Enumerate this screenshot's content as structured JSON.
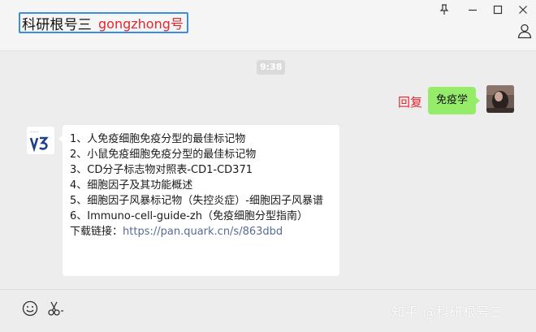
{
  "header": {
    "title": "科研根号三",
    "title_suffix": "gongzhong号"
  },
  "window_controls": {
    "pin": "pin-icon",
    "minimize": "minimize-icon",
    "maximize": "maximize-icon",
    "close": "close-icon"
  },
  "chat": {
    "timestamp": "9:38",
    "reply_label": "回复",
    "outgoing_message": "免疫学",
    "incoming_lines": [
      "1、人免疫细胞免疫分型的最佳标记物",
      "2、小鼠免疫细胞免疫分型的最佳标记物",
      "3、CD分子标志物对照表-CD1-CD371",
      "4、细胞因子及其功能概述",
      "5、细胞因子风暴标记物（失控炎症）-细胞因子风暴谱",
      "6、Immuno-cell-guide-zh（免疫细胞分型指南）"
    ],
    "download_label": "下载链接：",
    "download_link": "https://pan.quark.cn/s/863dbd"
  },
  "toolbar": {
    "emoji": "emoji-icon",
    "scissors": "scissors-icon",
    "watermark": "知乎 @科研根号三"
  },
  "colors": {
    "accent_red": "#e0282e",
    "bubble_green": "#95ec69",
    "link_blue": "#576b95",
    "title_border": "#3b8de0"
  }
}
